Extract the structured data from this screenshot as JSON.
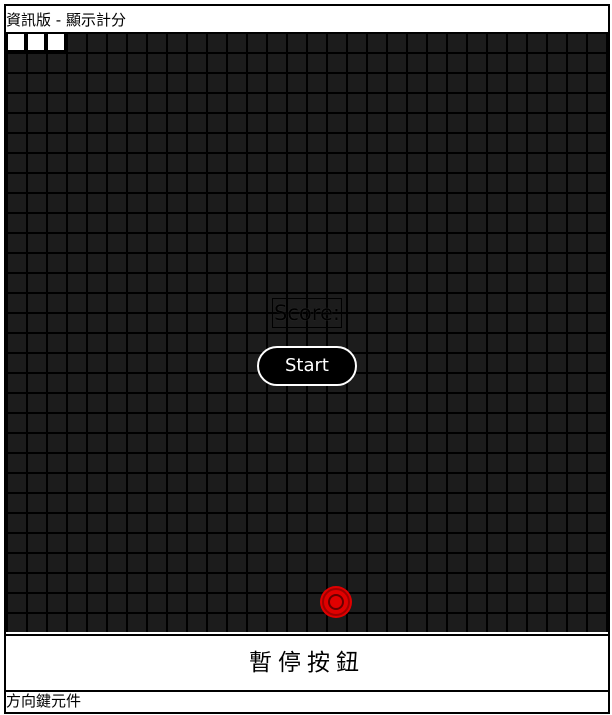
{
  "title_bar": {
    "text": "資訊版 - 顯示計分"
  },
  "board": {
    "columns": 30,
    "rows": 30,
    "cell_color": "#1c1c1c",
    "grid_color": "#000000",
    "snake": [
      [
        0,
        0
      ],
      [
        1,
        0
      ],
      [
        2,
        0
      ]
    ],
    "snake_color": "#ffffff",
    "food": [
      16,
      28
    ],
    "food_color": "#e00000"
  },
  "score": {
    "label": "Score:"
  },
  "start_button": {
    "label": "Start"
  },
  "pause_button": {
    "label": "暫停按鈕"
  },
  "footer": {
    "text": "方向鍵元件"
  }
}
